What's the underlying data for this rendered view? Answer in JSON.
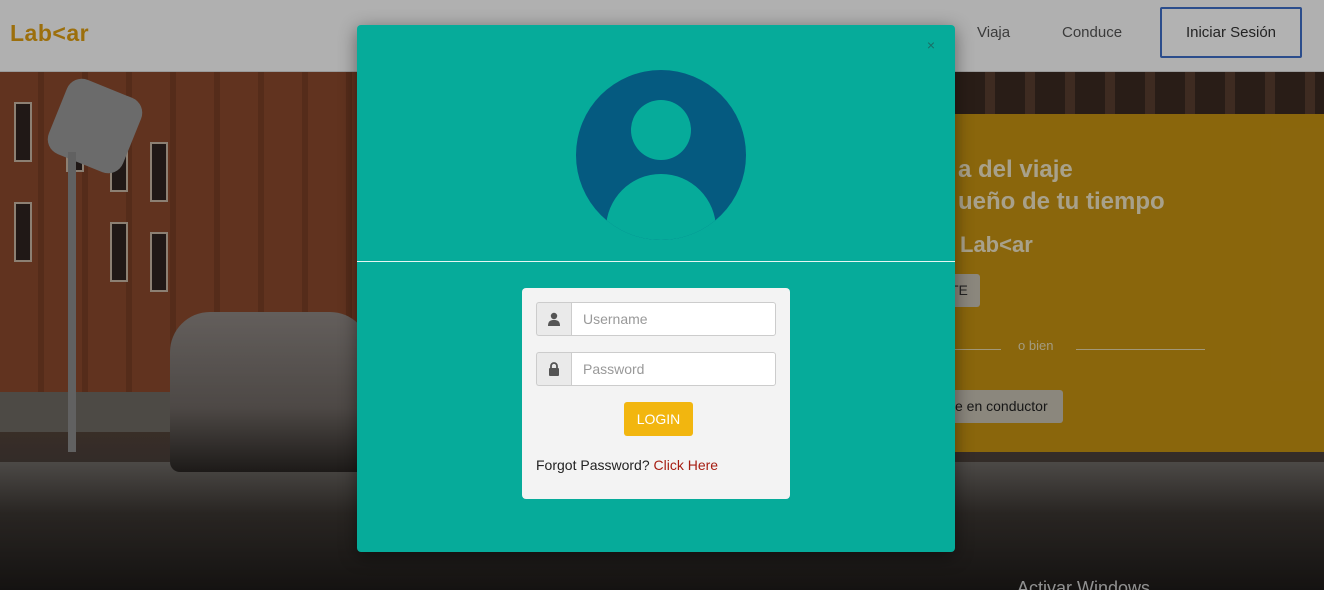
{
  "navbar": {
    "brand": "Lab<ar",
    "links": [
      "Viaja",
      "Conduce"
    ],
    "login_button": "Iniciar Sesión"
  },
  "promo": {
    "line1": "a del viaje",
    "line2": "ueño de tu tiempo",
    "brand": "Lab<ar",
    "primary_button": "TE",
    "separator": "o bien",
    "secondary_button": "e en conductor"
  },
  "watermark": "Activar Windows",
  "modal": {
    "close_symbol": "×",
    "avatar_icon": "user-avatar-icon",
    "username_placeholder": "Username",
    "password_placeholder": "Password",
    "login_button": "LOGIN",
    "forgot_text": "Forgot Password?",
    "forgot_link": "Click Here"
  },
  "colors": {
    "modal_bg": "#06ab9a",
    "avatar": "#055a80",
    "login_button": "#f2b60f",
    "link": "#a61d12",
    "brand": "#e0a012",
    "promo_bg": "#c69212"
  }
}
